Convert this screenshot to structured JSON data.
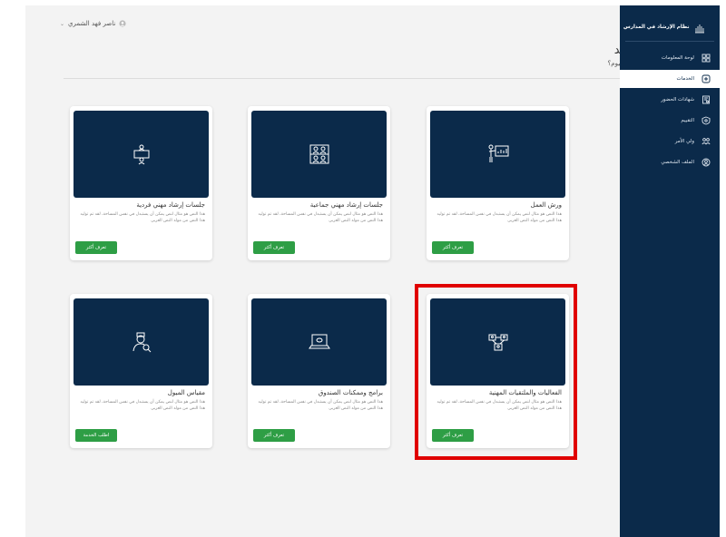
{
  "brand": {
    "title": "نظام الإرشاد في المدارس"
  },
  "user": {
    "name": "ناصر فهد الشمري"
  },
  "welcome": {
    "title": "مرحبا فهد",
    "subtitle": "عن ماذا تبحث اليوم؟"
  },
  "sidebar": {
    "items": [
      {
        "label": "لوحة المعلومات",
        "icon": "grid-icon",
        "active": false
      },
      {
        "label": "الخدمات",
        "icon": "services-icon",
        "active": true
      },
      {
        "label": "شهادات الحضور",
        "icon": "certificate-icon",
        "active": false
      },
      {
        "label": "التقييم",
        "icon": "rating-icon",
        "active": false
      },
      {
        "label": "ولي الأمر",
        "icon": "parent-icon",
        "active": false
      },
      {
        "label": "الملف الشخصي",
        "icon": "profile-icon",
        "active": false
      }
    ]
  },
  "cards": [
    {
      "title": "ورش العمل",
      "desc": "هذا النص هو مثال لنص يمكن أن يستبدل في نفس المساحة، لقد تم توليد هذا النص من مولد النص العربى",
      "button": "تعرف أكثر",
      "icon": "presentation-icon"
    },
    {
      "title": "جلسات إرشاد مهني جماعية",
      "desc": "هذا النص هو مثال لنص يمكن أن يستبدل في نفس المساحة، لقد تم توليد هذا النص من مولد النص العربى",
      "button": "تعرف أكثر",
      "icon": "group-session-icon"
    },
    {
      "title": "جلسات إرشاد مهني فردية",
      "desc": "هذا النص هو مثال لنص يمكن أن يستبدل في نفس المساحة، لقد تم توليد هذا النص من مولد النص العربى",
      "button": "تعرف أكثر",
      "icon": "individual-session-icon"
    },
    {
      "title": "الفعاليات والملتقيات المهنية",
      "desc": "هذا النص هو مثال لنص يمكن أن يستبدل في نفس المساحة، لقد تم توليد هذا النص من مولد النص العربى",
      "button": "تعرف أكثر",
      "icon": "network-icon"
    },
    {
      "title": "برامج وممكنات الصندوق",
      "desc": "هذا النص هو مثال لنص يمكن أن يستبدل في نفس المساحة، لقد تم توليد هذا النص من مولد النص العربى",
      "button": "تعرف أكثر",
      "icon": "laptop-icon"
    },
    {
      "title": "مقياس الميول",
      "desc": "هذا النص هو مثال لنص يمكن أن يستبدل في نفس المساحة، لقد تم توليد هذا النص من مولد النص العربى",
      "button": "اطلب الخدمة",
      "icon": "user-search-icon"
    }
  ],
  "colors": {
    "navy": "#0b2a4a",
    "green": "#2e9e45",
    "highlight": "#e00000"
  }
}
